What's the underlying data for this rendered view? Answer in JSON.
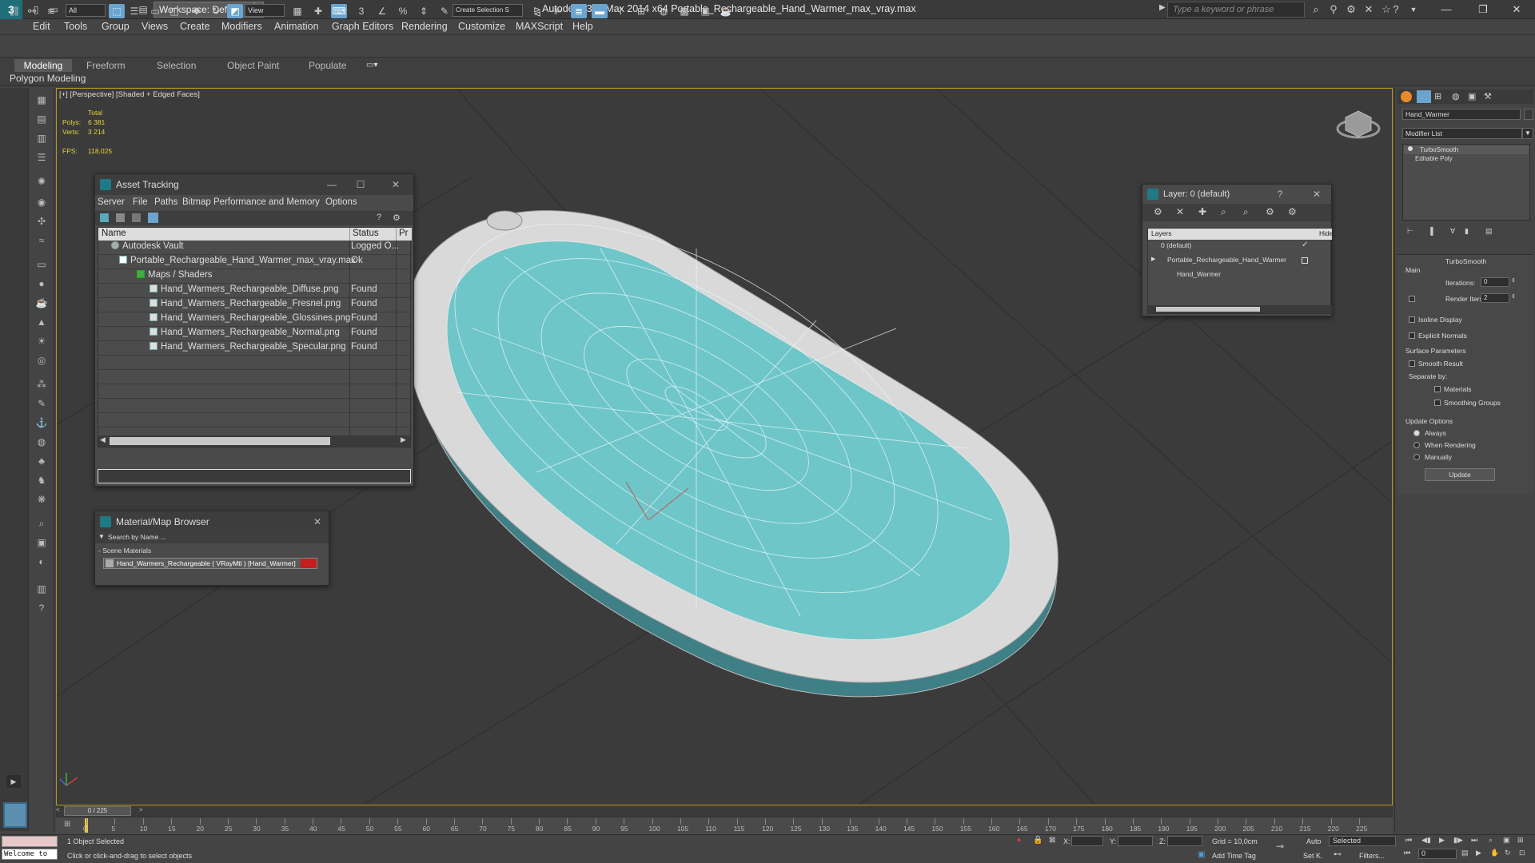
{
  "app": {
    "workspace_label": "Workspace: Default",
    "window_title": "Autodesk 3ds Max  2014 x64      Portable_Rechargeable_Hand_Warmer_max_vray.max",
    "search_placeholder": "Type a keyword or phrase"
  },
  "menu": [
    "Edit",
    "Tools",
    "Group",
    "Views",
    "Create",
    "Modifiers",
    "Animation",
    "Graph Editors",
    "Rendering",
    "Customize",
    "MAXScript",
    "Help"
  ],
  "toolbar": {
    "selection_filter": "All",
    "ref_coord": "View",
    "named_selection": "Create Selection S"
  },
  "ribbon": {
    "tabs": [
      "Modeling",
      "Freeform",
      "Selection",
      "Object Paint",
      "Populate"
    ],
    "sub_label": "Polygon Modeling"
  },
  "viewport": {
    "label": "[+] [Perspective] [Shaded + Edged Faces]",
    "stats_total": "Total",
    "polys_label": "Polys:",
    "polys_value": "6 381",
    "verts_label": "Verts:",
    "verts_value": "3 214",
    "fps_label": "FPS:",
    "fps_value": "118,025"
  },
  "asset_tracking": {
    "title": "Asset Tracking",
    "menu": [
      "Server",
      "File",
      "Paths",
      "Bitmap Performance and Memory",
      "Options"
    ],
    "col_name": "Name",
    "col_status": "Status",
    "col_extra": "Pr",
    "rows": [
      {
        "name": "Autodesk Vault",
        "status": "Logged O..."
      },
      {
        "name": "Portable_Rechargeable_Hand_Warmer_max_vray.max",
        "status": "Ok"
      },
      {
        "name": "Maps / Shaders",
        "status": ""
      },
      {
        "name": "Hand_Warmers_Rechargeable_Diffuse.png",
        "status": "Found"
      },
      {
        "name": "Hand_Warmers_Rechargeable_Fresnel.png",
        "status": "Found"
      },
      {
        "name": "Hand_Warmers_Rechargeable_Glossines.png",
        "status": "Found"
      },
      {
        "name": "Hand_Warmers_Rechargeable_Normal.png",
        "status": "Found"
      },
      {
        "name": "Hand_Warmers_Rechargeable_Specular.png",
        "status": "Found"
      }
    ]
  },
  "material_browser": {
    "title": "Material/Map Browser",
    "search_placeholder": "Search by Name ...",
    "group_label": "- Scene Materials",
    "item": "Hand_Warmers_Rechargeable  ( VRayMtl )  [Hand_Warmer]"
  },
  "layer_window": {
    "title": "Layer: 0 (default)",
    "help": "?",
    "col_layers": "Layers",
    "col_hide": "Hide",
    "rows": [
      "0 (default)",
      "Portable_Rechargeable_Hand_Warmer",
      "Hand_Warmer"
    ]
  },
  "command_panel": {
    "object_name": "Hand_Warmer",
    "modifier_list": "Modifier List",
    "stack": [
      "TurboSmooth",
      "Editable Poly"
    ],
    "rollout_title": "TurboSmooth",
    "main_label": "Main",
    "iterations_label": "Iterations:",
    "iterations_value": "0",
    "render_iters_label": "Render Iters:",
    "render_iters_value": "2",
    "isoline": "Isoline Display",
    "explicit_normals": "Explicit Normals",
    "surface_params": "Surface Parameters",
    "smooth_result": "Smooth Result",
    "separate_by": "Separate by:",
    "materials": "Materials",
    "smoothing_groups": "Smoothing Groups",
    "update_options": "Update Options",
    "always": "Always",
    "when_rendering": "When Rendering",
    "manually": "Manually",
    "update_button": "Update"
  },
  "timeline": {
    "frame_counter": "0 / 225",
    "ticks": [
      "0",
      "5",
      "10",
      "15",
      "20",
      "25",
      "30",
      "35",
      "40",
      "45",
      "50",
      "55",
      "60",
      "65",
      "70",
      "75",
      "80",
      "85",
      "90",
      "95",
      "100",
      "105",
      "110",
      "115",
      "120",
      "125",
      "130",
      "135",
      "140",
      "145",
      "150",
      "155",
      "160",
      "165",
      "170",
      "175",
      "180",
      "185",
      "190",
      "195",
      "200",
      "205",
      "210",
      "215",
      "220",
      "225"
    ]
  },
  "status": {
    "welcome": "Welcome to",
    "selected": "1 Object Selected",
    "hint": "Click or click-and-drag to select objects",
    "x_label": "X:",
    "y_label": "Y:",
    "z_label": "Z:",
    "grid": "Grid = 10,0cm",
    "auto": "Auto",
    "set_key": "Set K.",
    "selected_dropdown": "Selected",
    "filters": "Filters...",
    "add_time_tag": "Add Time Tag",
    "frame_field": "0"
  },
  "colors": {
    "accent": "#6aa4cf",
    "model_top": "#6ec6c9",
    "viewport_border": "#b99a22",
    "stats": "#e6d23c"
  }
}
